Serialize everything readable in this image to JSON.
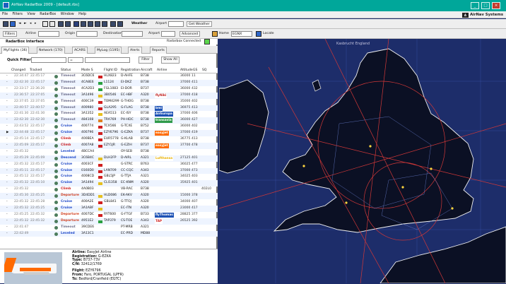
{
  "window": {
    "title": "AirNav RadarBox 2009 - [default.rbs]",
    "brand": "AirNav Systems"
  },
  "menu": [
    "File",
    "Filters",
    "View",
    "RadarBox",
    "Window",
    "Help"
  ],
  "toolbar": {
    "weather_label": "Weather",
    "airport_label": "Airport",
    "get_weather_label": "Get Weather"
  },
  "filterbar": {
    "filters_label": "Filters",
    "airline_label": "Airline",
    "origin_label": "Origin",
    "destination_label": "Destination",
    "airport_label": "Airport",
    "advanced_label": "Advanced",
    "home_label": "Home",
    "home_value": "EGNX",
    "locate_label": "Locate"
  },
  "panel": {
    "title": "RadarBox Interface",
    "connection_status": "Radarbox Connected",
    "status_color": "#5cd64c",
    "tabs": [
      "MyFlights (36)",
      "Network (170)",
      "ACARS",
      "MyLog (1195)",
      "Alerts",
      "Reports"
    ],
    "quick_filter_label": "Quick Filter:",
    "quick_filter_op": "=",
    "filter_button": "Filter",
    "show_all_button": "Show All"
  },
  "table": {
    "columns": [
      "Changed",
      "Tracked",
      "Status",
      "Mode S",
      "Flight ID",
      "Registration",
      "Aircraft",
      "Airline",
      "Altitude",
      "GS",
      "SQ"
    ],
    "rows": [
      {
        "changed": "22:34:47",
        "tracked": "22:45:17",
        "status": "Timeout",
        "mode": "3C6DC6",
        "flight": "HLX823",
        "reg": "D-AHFE",
        "ac": "B738",
        "airline": "",
        "alt": "36000",
        "gs": "11",
        "sq": "",
        "flag": "#d02020"
      },
      {
        "changed": "22:42:30",
        "tracked": "22:45:17",
        "status": "Timeout",
        "mode": "4CA8E6",
        "flight": "L1124",
        "reg": "EI-DKZ",
        "ac": "B738",
        "airline": "",
        "alt": "37000",
        "gs": "411",
        "sq": "",
        "flag": "#2aa040"
      },
      {
        "changed": "22:33:17",
        "tracked": "22:36:20",
        "status": "Timeout",
        "mode": "4CA2D3",
        "flight": "FGL1083",
        "reg": "EI-DOR",
        "ac": "B737",
        "airline": "",
        "alt": "36000",
        "gs": "432",
        "sq": "",
        "flag": "#2aa040"
      },
      {
        "changed": "22:36:57",
        "tracked": "22:37:05",
        "status": "Timeout",
        "mode": "3A1496",
        "flight": "3B0546",
        "reg": "EC-HBF",
        "ac": "A320",
        "airline": "flyNiki",
        "alt": "37000",
        "gs": "418",
        "sq": "",
        "flag": "#e6c020"
      },
      {
        "changed": "22:37:05",
        "tracked": "22:37:05",
        "status": "Timeout",
        "mode": "400C39",
        "flight": "TOM4299",
        "reg": "G-THOG",
        "ac": "B738",
        "airline": "",
        "alt": "35000",
        "gs": "402",
        "sq": "",
        "flag": "#d02020"
      },
      {
        "changed": "22:40:57",
        "tracked": "22:40:57",
        "status": "Timeout",
        "mode": "400980",
        "flight": "GLA295",
        "reg": "G-FLAG",
        "ac": "B738",
        "airline": "bmi",
        "alt": "36975",
        "gs": "413",
        "sq": "",
        "flag": "#d02020"
      },
      {
        "changed": "22:41:30",
        "tracked": "22:41:30",
        "status": "Timeout",
        "mode": "3A1352",
        "flight": "AEA513",
        "reg": "EC-ISY",
        "ac": "B738",
        "airline": "AirEuropa",
        "alt": "37000",
        "gs": "406",
        "sq": "",
        "flag": "#e6c020"
      },
      {
        "changed": "22:42:30",
        "tracked": "22:42:30",
        "status": "Timeout",
        "mode": "484108",
        "flight": "TRA769",
        "reg": "PH-HDC",
        "ac": "B738",
        "airline": "transavia",
        "alt": "36000",
        "gs": "427",
        "sq": "",
        "flag": "#e08020"
      },
      {
        "changed": "22:43:52",
        "tracked": "22:45:17",
        "status": "Cruise",
        "mode": "400774",
        "flight": "TCX566",
        "reg": "G-TCXE",
        "ac": "B752",
        "airline": "",
        "alt": "36000",
        "gs": "402",
        "sq": "",
        "flag": "#d02020"
      },
      {
        "changed": "22:44:48",
        "tracked": "22:45:17",
        "status": "Cruise",
        "mode": "400796",
        "flight": "EZY6796",
        "reg": "G-EZKA",
        "ac": "B737",
        "airline": "easyJet",
        "alt": "37000",
        "gs": "419",
        "sq": "",
        "flag": "#d02020"
      },
      {
        "changed": "22:45:14",
        "tracked": "22:45:17",
        "status": "Climb",
        "mode": "400BEA",
        "flight": "EUR5778",
        "reg": "G-KLAB",
        "ac": "B738",
        "airline": "",
        "alt": "36775",
        "gs": "413",
        "sq": "",
        "flag": "#d02020"
      },
      {
        "changed": "22:45:09",
        "tracked": "22:45:17",
        "status": "Climb",
        "mode": "4007A8",
        "flight": "EZY1JR",
        "reg": "G-EZIH",
        "ac": "B737",
        "airline": "easyJet",
        "alt": "37700",
        "gs": "478",
        "sq": "",
        "flag": "#d02020"
      },
      {
        "changed": "22:45:32",
        "tracked": "",
        "status": "Leveled",
        "mode": "4BCCA4",
        "flight": "",
        "reg": "OY-SEB",
        "ac": "B738",
        "airline": "",
        "alt": "",
        "gs": "",
        "sq": "",
        "flag": ""
      },
      {
        "changed": "22:45:29",
        "tracked": "22:45:09",
        "status": "Descend",
        "mode": "3C6B4C",
        "flight": "DLH2FP",
        "reg": "D-AIRL",
        "ac": "A321",
        "airline": "Lufthansa",
        "alt": "27125",
        "gs": "401",
        "sq": "",
        "flag": "#e6c020"
      },
      {
        "changed": "22:45:32",
        "tracked": "22:45:17",
        "status": "Cruise",
        "mode": "4003CF",
        "flight": "",
        "reg": "G-STRC",
        "ac": "B763",
        "airline": "",
        "alt": "36025",
        "gs": "477",
        "sq": "",
        "flag": "#d02020"
      },
      {
        "changed": "22:45:11",
        "tracked": "22:45:17",
        "status": "Cruise",
        "mode": "0160D0",
        "flight": "LAN709",
        "reg": "CC-CQC",
        "ac": "A343",
        "airline": "",
        "alt": "37000",
        "gs": "473",
        "sq": "",
        "flag": "#d02020"
      },
      {
        "changed": "22:45:12",
        "tracked": "22:45:17",
        "status": "Cruise",
        "mode": "4008CD",
        "flight": "GBL5JP",
        "reg": "G-TTJA",
        "ac": "A321",
        "airline": "",
        "alt": "34025",
        "gs": "403",
        "sq": "",
        "flag": "#d02020"
      },
      {
        "changed": "22:45:32",
        "tracked": "22:45:10",
        "status": "Cruise",
        "mode": "3A1494",
        "flight": "CLI1358",
        "reg": "EC-KNM",
        "ac": "A320",
        "airline": "",
        "alt": "35925",
        "gs": "401",
        "sq": "",
        "flag": "#e6c020"
      },
      {
        "changed": "22:45:32",
        "tracked": "",
        "status": "Climb",
        "mode": "4A0B03",
        "flight": "",
        "reg": "VB-RAC",
        "ac": "B738",
        "airline": "",
        "alt": "",
        "gs": "",
        "sq": "402L0",
        "flag": ""
      },
      {
        "changed": "22:45:30",
        "tracked": "22:45:25",
        "status": "Departure",
        "mode": "3D4DD1",
        "flight": "HLD086",
        "reg": "EK-AKV",
        "ac": "A320",
        "airline": "",
        "alt": "15000",
        "gs": "378",
        "sq": "",
        "flag": "#e6c020"
      },
      {
        "changed": "22:45:32",
        "tracked": "22:45:28",
        "status": "Cruise",
        "mode": "400A2E",
        "flight": "GBL841",
        "reg": "G-TTOJ",
        "ac": "A320",
        "airline": "",
        "alt": "34000",
        "gs": "407",
        "sq": "",
        "flag": "#d02020"
      },
      {
        "changed": "22:45:32",
        "tracked": "22:45:25",
        "status": "Cruise",
        "mode": "3A1ABF",
        "flight": "",
        "reg": "EC-ITN",
        "ac": "A320",
        "airline": "",
        "alt": "23000",
        "gs": "417",
        "sq": "",
        "flag": "#e6c020"
      },
      {
        "changed": "22:45:25",
        "tracked": "22:45:32",
        "status": "Departure",
        "mode": "4007DC",
        "flight": "RYT600",
        "reg": "G-FTGF",
        "ac": "B733",
        "airline": "flyThomas",
        "alt": "28825",
        "gs": "377",
        "sq": "",
        "flag": "#d02020"
      },
      {
        "changed": "22:45:32",
        "tracked": "22:45:32",
        "status": "Departure",
        "mode": "4951E2",
        "flight": "TAP379",
        "reg": "CS-TOE",
        "ac": "A343",
        "airline": "TAP",
        "alt": "26525",
        "gs": "392",
        "sq": "",
        "flag": "#2aa040"
      },
      {
        "changed": "22:41:47",
        "tracked": "",
        "status": "Timeout",
        "mode": "39CDE6",
        "flight": "",
        "reg": "PT-MRB",
        "ac": "A321",
        "airline": "",
        "alt": "",
        "gs": "",
        "sq": "",
        "flag": ""
      },
      {
        "changed": "22:42:49",
        "tracked": "",
        "status": "Leveled",
        "mode": "3A13C1",
        "flight": "",
        "reg": "EC-PRD",
        "ac": "MD88",
        "airline": "",
        "alt": "",
        "gs": "",
        "sq": "",
        "flag": ""
      }
    ]
  },
  "status_colors": {
    "Timeout": "#6f6f8c",
    "Cruise": "#1e48c8",
    "Climb": "#cc2020",
    "Leveled": "#1e48c8",
    "Descend": "#1e48c8",
    "Departure": "#d04020"
  },
  "airline_colors": {
    "flyNiki": [
      "#ffffff",
      "#c02020"
    ],
    "bmi": [
      "#1d52b5",
      "#ffffff"
    ],
    "AirEuropa": [
      "#1d52b5",
      "#ffffff"
    ],
    "transavia": [
      "#2f9a4a",
      "#ffffff"
    ],
    "easyJet": [
      "#ff6a00",
      "#ffffff"
    ],
    "Lufthansa": [
      "#ffffff",
      "#e8b000"
    ],
    "flyThomas": [
      "#1d52b5",
      "#ffffff"
    ],
    "TAP": [
      "#ffffff",
      "#d02020"
    ]
  },
  "details": {
    "airline_label": "Airline:",
    "airline_value": "EasyJet Airline",
    "registration_label": "Registration:",
    "registration_value": "G-EZKA",
    "type_label": "Type:",
    "type_value": "B737-73V",
    "cn_label": "C/N:",
    "cn_value": "32412/1769",
    "flight_label": "Flight:",
    "flight_value": "EZY6796",
    "from_label": "From:",
    "from_value": "Faro, PORTUGAL (LPFR)",
    "to_label": "To:",
    "to_value": "Bedford/Cranfield (EGTC)"
  },
  "map": {
    "region_label": "Kasbrucht England",
    "colors": {
      "water": "#1d2d6a",
      "land": "#0b1024",
      "coast": "#f0f0f0",
      "route": "#d13838",
      "grid": "#3a51a8"
    }
  }
}
